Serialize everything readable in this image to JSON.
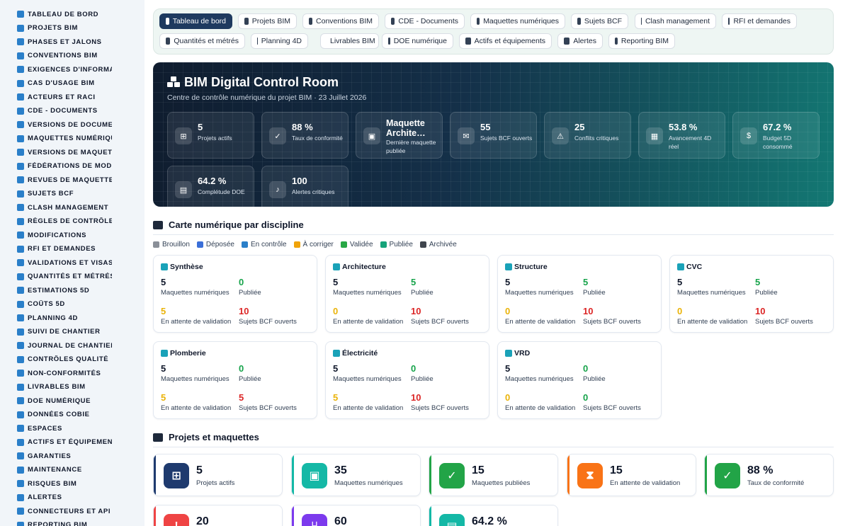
{
  "sidebar": {
    "items": [
      {
        "label": "TABLEAU DE BORD",
        "icon": "gauge-icon"
      },
      {
        "label": "PROJETS BIM",
        "icon": "project-diagram-icon"
      },
      {
        "label": "PHASES ET JALONS",
        "icon": "layers-icon"
      },
      {
        "label": "CONVENTIONS BIM",
        "icon": "book-icon"
      },
      {
        "label": "EXIGENCES D'INFORMATI",
        "icon": "clipboard-icon"
      },
      {
        "label": "CAS D'USAGE BIM",
        "icon": "lightbulb-icon"
      },
      {
        "label": "ACTEURS ET RACI",
        "icon": "users-icon"
      },
      {
        "label": "CDE - DOCUMENTS",
        "icon": "folder-icon"
      },
      {
        "label": "VERSIONS DE DOCUMEN",
        "icon": "code-branch-icon"
      },
      {
        "label": "MAQUETTES NUMÉRIQU",
        "icon": "cubes-icon"
      },
      {
        "label": "VERSIONS DE MAQUETT",
        "icon": "code-branch-icon"
      },
      {
        "label": "FÉDÉRATIONS DE MODÈ",
        "icon": "sitemap-icon"
      },
      {
        "label": "REVUES DE MAQUETTES",
        "icon": "search-icon"
      },
      {
        "label": "SUJETS BCF",
        "icon": "comments-icon"
      },
      {
        "label": "CLASH MANAGEMENT",
        "icon": "warning-icon"
      },
      {
        "label": "RÈGLES DE CONTRÔLE",
        "icon": "cogs-icon"
      },
      {
        "label": "MODIFICATIONS",
        "icon": "edit-icon"
      },
      {
        "label": "RFI ET DEMANDES",
        "icon": "question-icon"
      },
      {
        "label": "VALIDATIONS ET VISAS",
        "icon": "check-icon"
      },
      {
        "label": "QUANTITÉS ET MÉTRÉS",
        "icon": "calculator-icon"
      },
      {
        "label": "ESTIMATIONS 5D",
        "icon": "coins-icon"
      },
      {
        "label": "COÛTS 5D",
        "icon": "money-icon"
      },
      {
        "label": "PLANNING 4D",
        "icon": "calendar-icon"
      },
      {
        "label": "SUIVI DE CHANTIER",
        "icon": "hardhat-icon"
      },
      {
        "label": "JOURNAL DE CHANTIER",
        "icon": "journal-icon"
      },
      {
        "label": "CONTRÔLES QUALITÉ",
        "icon": "shield-check-icon"
      },
      {
        "label": "NON-CONFORMITÉS",
        "icon": "bug-icon"
      },
      {
        "label": "LIVRABLES BIM",
        "icon": "box-icon"
      },
      {
        "label": "DOE NUMÉRIQUE",
        "icon": "book-open-icon"
      },
      {
        "label": "DONNÉES COBIE",
        "icon": "table-icon"
      },
      {
        "label": "ESPACES",
        "icon": "door-icon"
      },
      {
        "label": "ACTIFS ET ÉQUIPEMENT",
        "icon": "cogs-icon"
      },
      {
        "label": "GARANTIES",
        "icon": "certificate-icon"
      },
      {
        "label": "MAINTENANCE",
        "icon": "wrench-icon"
      },
      {
        "label": "RISQUES BIM",
        "icon": "triangle-icon"
      },
      {
        "label": "ALERTES",
        "icon": "bell-icon"
      },
      {
        "label": "CONNECTEURS ET API",
        "icon": "plug-icon"
      },
      {
        "label": "REPORTING BIM",
        "icon": "chart-icon"
      }
    ]
  },
  "topnav": {
    "tabs": [
      {
        "label": "Tableau de bord",
        "icon": "gauge-icon",
        "active": true
      },
      {
        "label": "Projets BIM",
        "icon": "project-diagram-icon"
      },
      {
        "label": "Conventions BIM",
        "icon": "book-icon"
      },
      {
        "label": "CDE - Documents",
        "icon": "folder-icon"
      },
      {
        "label": "Maquettes numériques",
        "icon": "cubes-icon"
      },
      {
        "label": "Sujets BCF",
        "icon": "comments-icon"
      },
      {
        "label": "Clash management",
        "icon": "warning-icon"
      },
      {
        "label": "RFI et demandes",
        "icon": "question-icon"
      },
      {
        "label": "Quantités et métrés",
        "icon": "calculator-icon"
      },
      {
        "label": "Planning 4D",
        "icon": "calendar-icon"
      },
      {
        "label": "Livrables BIM",
        "icon": "box-icon"
      },
      {
        "label": "DOE numérique",
        "icon": "book-open-icon"
      },
      {
        "label": "Actifs et équipements",
        "icon": "cogs-icon"
      },
      {
        "label": "Alertes",
        "icon": "bell-icon"
      },
      {
        "label": "Reporting BIM",
        "icon": "chart-icon"
      }
    ]
  },
  "hero": {
    "title": "BIM Digital Control Room",
    "subtitle": "Centre de contrôle numérique du projet BIM · 23 Juillet 2026",
    "kpis": [
      {
        "value": "5",
        "label": "Projets actifs",
        "icon": "project-diagram-icon"
      },
      {
        "value": "88 %",
        "label": "Taux de conformité",
        "icon": "check-double-icon"
      },
      {
        "value": "Maquette Archite…",
        "label": "Dernière maquette publiée",
        "icon": "cubes-icon"
      },
      {
        "value": "55",
        "label": "Sujets BCF ouverts",
        "icon": "comments-icon"
      },
      {
        "value": "25",
        "label": "Conflits critiques",
        "icon": "warning-icon"
      },
      {
        "value": "53.8 %",
        "label": "Avancement 4D réel",
        "icon": "calendar-icon"
      },
      {
        "value": "67.2 %",
        "label": "Budget 5D consommé",
        "icon": "money-icon"
      },
      {
        "value": "64.2 %",
        "label": "Complétude DOE",
        "icon": "book-open-icon"
      },
      {
        "value": "100",
        "label": "Alertes critiques",
        "icon": "bell-icon"
      }
    ]
  },
  "disciplines": {
    "title": "Carte numérique par discipline",
    "legend": [
      {
        "label": "Brouillon",
        "color": "#8a8f98"
      },
      {
        "label": "Déposée",
        "color": "#3b6fd8"
      },
      {
        "label": "En contrôle",
        "color": "#2a7fc9"
      },
      {
        "label": "À corriger",
        "color": "#f0a30a"
      },
      {
        "label": "Validée",
        "color": "#28a745"
      },
      {
        "label": "Publiée",
        "color": "#16a37a"
      },
      {
        "label": "Archivée",
        "color": "#3f454d"
      }
    ],
    "labels": {
      "models": "Maquettes numériques",
      "published": "Publiée",
      "pending": "En attente de validation",
      "bcf": "Sujets BCF ouverts"
    },
    "cards": [
      {
        "name": "Synthèse",
        "models": "5",
        "published": "0",
        "pending": "5",
        "bcf": "10"
      },
      {
        "name": "Architecture",
        "models": "5",
        "published": "5",
        "pending": "0",
        "bcf": "10"
      },
      {
        "name": "Structure",
        "models": "5",
        "published": "5",
        "pending": "0",
        "bcf": "10"
      },
      {
        "name": "CVC",
        "models": "5",
        "published": "5",
        "pending": "0",
        "bcf": "10"
      },
      {
        "name": "Plomberie",
        "models": "5",
        "published": "0",
        "pending": "5",
        "bcf": "5"
      },
      {
        "name": "Électricité",
        "models": "5",
        "published": "0",
        "pending": "5",
        "bcf": "10"
      },
      {
        "name": "VRD",
        "models": "5",
        "published": "0",
        "pending": "0",
        "bcf": "0"
      }
    ]
  },
  "projects": {
    "title": "Projets et maquettes",
    "cards": [
      {
        "value": "5",
        "label": "Projets actifs",
        "icon": "project-diagram-icon",
        "color": "#1e3a6e"
      },
      {
        "value": "35",
        "label": "Maquettes numériques",
        "icon": "cubes-icon",
        "color": "#14b8a6"
      },
      {
        "value": "15",
        "label": "Maquettes publiées",
        "icon": "check-circle-icon",
        "color": "#22a447"
      },
      {
        "value": "15",
        "label": "En attente de validation",
        "icon": "hourglass-icon",
        "color": "#f97316"
      },
      {
        "value": "88 %",
        "label": "Taux de conformité",
        "icon": "check-double-icon",
        "color": "#22a447"
      },
      {
        "value": "20",
        "label": "",
        "icon": "alert-icon",
        "color": "#ef4444"
      },
      {
        "value": "60",
        "label": "",
        "icon": "code-branch-icon",
        "color": "#7c3aed"
      },
      {
        "value": "64.2 %",
        "label": "",
        "icon": "book-open-icon",
        "color": "#14b8a6"
      }
    ]
  }
}
